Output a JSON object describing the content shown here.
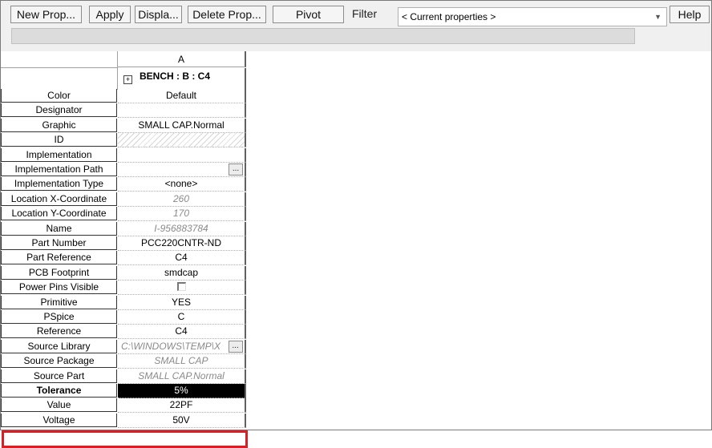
{
  "toolbar": {
    "new_prop": "New Prop...",
    "apply": "Apply",
    "display": "Displa...",
    "delete_prop": "Delete Prop...",
    "pivot": "Pivot",
    "filter_label": "Filter",
    "filter_value": "< Current properties >",
    "help": "Help"
  },
  "grid": {
    "column_header": "A",
    "title": "BENCH : B : C4",
    "rows": [
      {
        "label": "Color",
        "value": "Default"
      },
      {
        "label": "Designator",
        "value": ""
      },
      {
        "label": "Graphic",
        "value": "SMALL CAP.Normal"
      },
      {
        "label": "ID",
        "value": ""
      },
      {
        "label": "Implementation",
        "value": ""
      },
      {
        "label": "Implementation Path",
        "value": ""
      },
      {
        "label": "Implementation Type",
        "value": "<none>"
      },
      {
        "label": "Location X-Coordinate",
        "value": "260"
      },
      {
        "label": "Location Y-Coordinate",
        "value": "170"
      },
      {
        "label": "Name",
        "value": "I-956883784"
      },
      {
        "label": "Part Number",
        "value": "PCC220CNTR-ND"
      },
      {
        "label": "Part Reference",
        "value": "C4"
      },
      {
        "label": "PCB Footprint",
        "value": "smdcap"
      },
      {
        "label": "Power Pins Visible",
        "value": ""
      },
      {
        "label": "Primitive",
        "value": "YES"
      },
      {
        "label": "PSpice",
        "value": "C"
      },
      {
        "label": "Reference",
        "value": "C4"
      },
      {
        "label": "Source Library",
        "value": "C:\\WINDOWS\\TEMP\\X"
      },
      {
        "label": "Source Package",
        "value": "SMALL CAP"
      },
      {
        "label": "Source Part",
        "value": "SMALL CAP.Normal"
      },
      {
        "label": "Tolerance",
        "value": "5%"
      },
      {
        "label": "Value",
        "value": "22PF"
      },
      {
        "label": "Voltage",
        "value": "50V"
      }
    ]
  },
  "ui": {
    "ellipsis": "...",
    "expand": "+",
    "dropdown_arrow": "▼"
  }
}
